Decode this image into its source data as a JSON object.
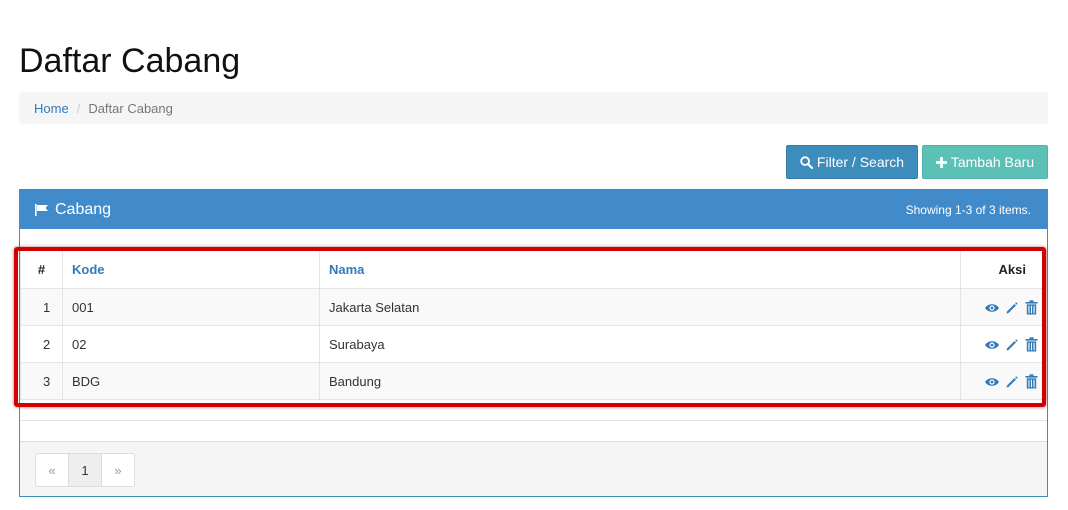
{
  "page": {
    "title": "Daftar Cabang"
  },
  "breadcrumb": {
    "home": "Home",
    "separator": "/",
    "current": "Daftar Cabang"
  },
  "toolbar": {
    "filter_label": "Filter / Search",
    "add_label": "Tambah Baru"
  },
  "panel": {
    "title": "Cabang",
    "summary": "Showing 1-3 of 3 items."
  },
  "table": {
    "headers": {
      "num": "#",
      "kode": "Kode",
      "nama": "Nama",
      "aksi": "Aksi"
    },
    "rows": [
      {
        "num": "1",
        "kode": "001",
        "nama": "Jakarta Selatan"
      },
      {
        "num": "2",
        "kode": "02",
        "nama": "Surabaya"
      },
      {
        "num": "3",
        "kode": "BDG",
        "nama": "Bandung"
      }
    ],
    "row_actions": [
      "view-icon",
      "edit-icon",
      "delete-icon"
    ]
  },
  "pagination": {
    "prev": "«",
    "current": "1",
    "next": "»"
  },
  "colors": {
    "primary": "#428bca",
    "filter_button": "#3c8dbc",
    "add_button": "#5bc0b5",
    "highlight": "#d40000",
    "link": "#337ab7"
  }
}
